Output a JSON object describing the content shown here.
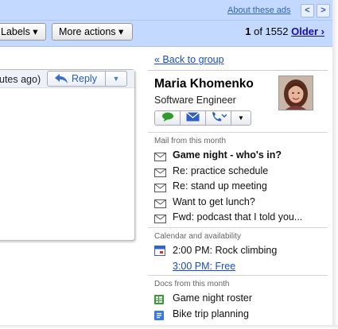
{
  "ads": {
    "about_label": "About these ads",
    "prev_arrow": "<",
    "next_arrow": ">"
  },
  "toolbar": {
    "labels_button": "Labels ▾",
    "more_actions_button": "More actions ▾",
    "page_position": "1",
    "page_of": " of 1552 ",
    "older_link": "Older ›"
  },
  "message": {
    "timestamp": "utes ago)",
    "reply_label": "Reply",
    "reply_dropdown": "▼"
  },
  "sidebar": {
    "back_link": "« Back to group",
    "contact": {
      "name": "Maria Khomenko",
      "title": "Software Engineer",
      "actions": [
        "chat-icon",
        "email-icon",
        "phone-icon",
        "more-dropdown"
      ]
    },
    "mail_section": {
      "heading": "Mail from this month",
      "items": [
        {
          "label": "Game night - who's in?",
          "unread": true
        },
        {
          "label": "Re: practice schedule",
          "unread": false
        },
        {
          "label": "Re: stand up meeting",
          "unread": false
        },
        {
          "label": "Want to get lunch?",
          "unread": false
        },
        {
          "label": "Fwd: podcast that I told you...",
          "unread": false
        }
      ]
    },
    "calendar_section": {
      "heading": "Calendar and availability",
      "event_label": "2:00 PM: Rock climbing",
      "free_link": "3:00 PM: Free"
    },
    "docs_section": {
      "heading": "Docs from this month",
      "items": [
        {
          "label": "Game night roster",
          "icon": "spreadsheet-icon"
        },
        {
          "label": "Bike trip planning",
          "icon": "document-icon"
        }
      ]
    }
  },
  "colors": {
    "toolbar_bg": "#c3d9ff",
    "link": "#1a4dbb",
    "chat_green": "#2e9b2e"
  }
}
